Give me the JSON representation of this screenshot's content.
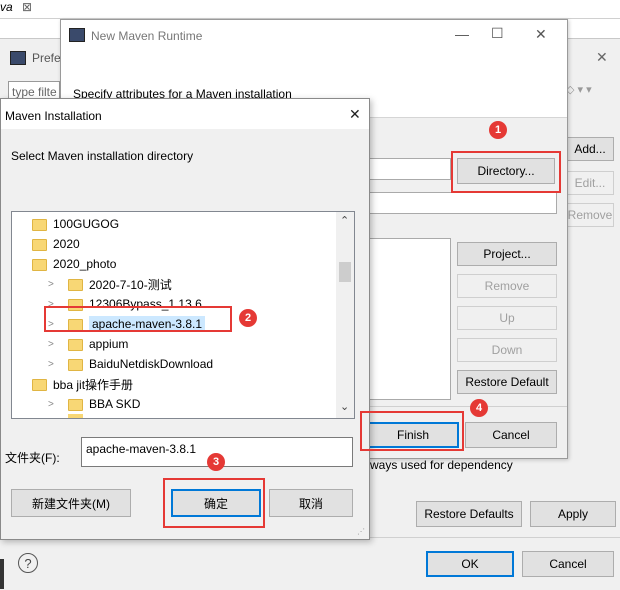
{
  "editor_tab": {
    "label": "va",
    "close": "⊠"
  },
  "preferences": {
    "title": "Prefe",
    "close": "✕",
    "filter_placeholder": "type filte",
    "add_button": "Add...",
    "edit_button": "Edit...",
    "remove_button": "Remove",
    "always_used_text": "ways used for dependency",
    "restore_defaults_button": "Restore Defaults",
    "apply_button": "Apply",
    "ok_button": "OK",
    "cancel_button": "Cancel",
    "help_icon": "?"
  },
  "maven_runtime": {
    "title": "New Maven Runtime",
    "minimize": "—",
    "maximize": "☐",
    "close": "✕",
    "description": "Specify attributes for a Maven installation",
    "directory_button": "Directory...",
    "project_button": "Project...",
    "remove_button": "Remove",
    "up_button": "Up",
    "down_button": "Down",
    "restore_default_button": "Restore Default",
    "finish_button": "Finish",
    "cancel_button": "Cancel"
  },
  "maven_installation": {
    "title": "Maven Installation",
    "close": "✕",
    "prompt": "Select Maven installation directory",
    "tree": [
      {
        "label": "100GUGOG",
        "expandable": false,
        "selected": false
      },
      {
        "label": "2020",
        "expandable": false,
        "selected": false
      },
      {
        "label": "2020_photo",
        "expandable": false,
        "selected": false
      },
      {
        "label": "2020-7-10-测试",
        "expandable": true,
        "selected": false
      },
      {
        "label": "12306Bypass_1.13.6",
        "expandable": true,
        "selected": false
      },
      {
        "label": "apache-maven-3.8.1",
        "expandable": true,
        "selected": true
      },
      {
        "label": "appium",
        "expandable": true,
        "selected": false
      },
      {
        "label": "BaiduNetdiskDownload",
        "expandable": true,
        "selected": false
      },
      {
        "label": "bba jit操作手册",
        "expandable": false,
        "selected": false
      },
      {
        "label": "BBA SKD",
        "expandable": true,
        "selected": false
      }
    ],
    "folder_label": "文件夹(F):",
    "folder_value": "apache-maven-3.8.1",
    "new_folder_button": "新建文件夹(M)",
    "confirm_button": "确定",
    "cancel_button": "取消"
  },
  "annotations": {
    "step1": "1",
    "step2": "2",
    "step3": "3",
    "step4": "4",
    "accent_color": "#e53935"
  }
}
